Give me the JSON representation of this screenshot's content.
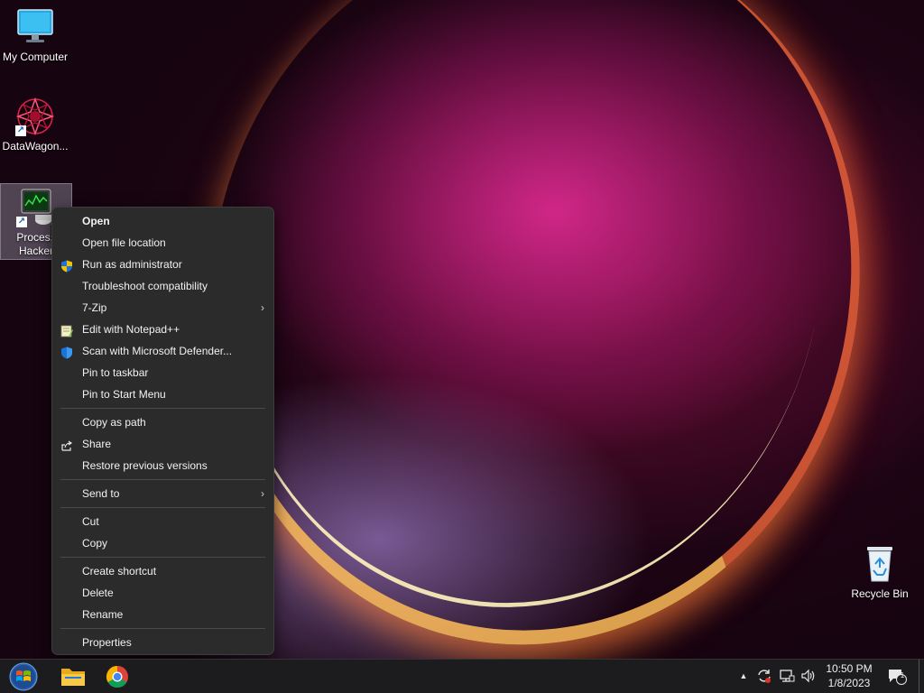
{
  "desktop": {
    "icons": [
      {
        "label": "My Computer",
        "icon": "monitor-icon"
      },
      {
        "label": "DataWagon...",
        "icon": "datawagon-icon"
      },
      {
        "label": "Process Hacker",
        "label_line1": "Process",
        "label_line2": "Hacker",
        "icon": "process-hacker-icon"
      },
      {
        "label": "Recycle Bin",
        "icon": "recycle-bin-icon"
      }
    ]
  },
  "context_menu": {
    "items": [
      {
        "label": "Open",
        "bold": true
      },
      {
        "label": "Open file location"
      },
      {
        "label": "Run as administrator",
        "icon": "uac-shield-icon"
      },
      {
        "label": "Troubleshoot compatibility"
      },
      {
        "label": "7-Zip",
        "submenu": true
      },
      {
        "label": "Edit with Notepad++",
        "icon": "notepad-plus-plus-icon"
      },
      {
        "label": "Scan with Microsoft Defender...",
        "icon": "defender-shield-icon"
      },
      {
        "label": "Pin to taskbar"
      },
      {
        "label": "Pin to Start Menu"
      },
      {
        "label": "Copy as path"
      },
      {
        "label": "Share",
        "icon": "share-icon"
      },
      {
        "label": "Restore previous versions"
      },
      {
        "label": "Send to",
        "submenu": true
      },
      {
        "label": "Cut"
      },
      {
        "label": "Copy"
      },
      {
        "label": "Create shortcut"
      },
      {
        "label": "Delete"
      },
      {
        "label": "Rename"
      },
      {
        "label": "Properties"
      }
    ],
    "submenu_glyph": "›"
  },
  "taskbar": {
    "pinned": [
      {
        "name": "start-button",
        "icon": "windows-orb-icon"
      },
      {
        "name": "file-explorer",
        "icon": "folder-icon"
      },
      {
        "name": "google-chrome",
        "icon": "chrome-icon"
      }
    ],
    "tray": {
      "overflow_glyph": "▲",
      "icons": [
        "sync-icon",
        "network-icon",
        "volume-icon"
      ],
      "time": "10:50 PM",
      "date": "1/8/2023",
      "notification_count": "1"
    }
  },
  "colors": {
    "menu_bg": "#2b2b2b",
    "menu_text": "#f2f2f2",
    "taskbar_bg": "#1c1c1e",
    "shield_blue": "#1e73d8",
    "shield_yellow": "#f2c200"
  }
}
